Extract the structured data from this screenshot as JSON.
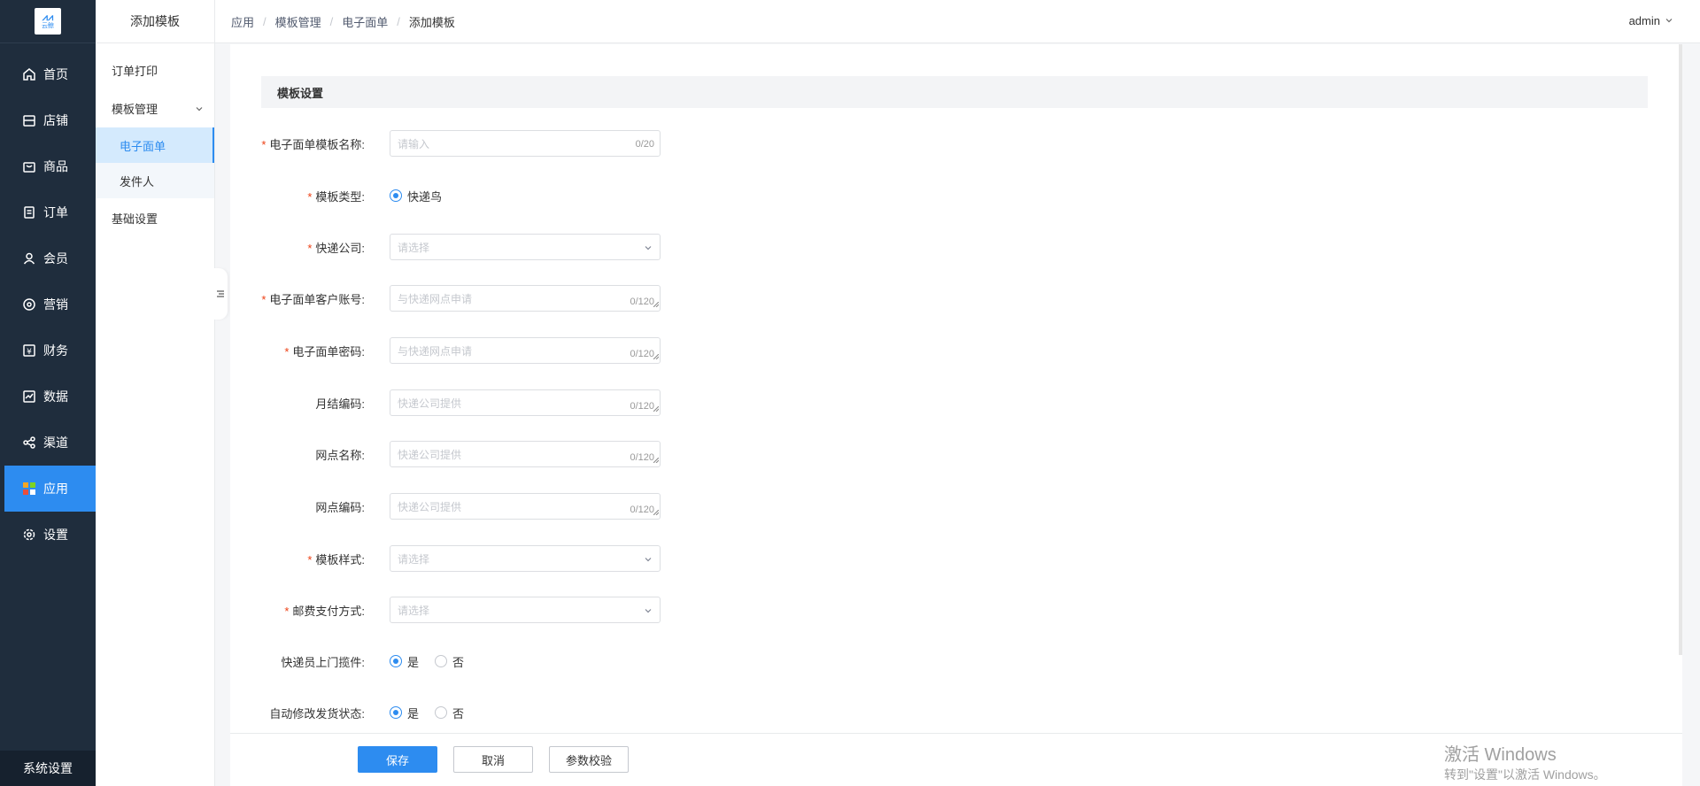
{
  "nav": {
    "logo_text": "云鲸",
    "items": [
      {
        "label": "首页",
        "icon": "home-icon"
      },
      {
        "label": "店铺",
        "icon": "store-icon"
      },
      {
        "label": "商品",
        "icon": "bag-icon"
      },
      {
        "label": "订单",
        "icon": "order-icon"
      },
      {
        "label": "会员",
        "icon": "user-icon"
      },
      {
        "label": "营销",
        "icon": "marketing-icon"
      },
      {
        "label": "财务",
        "icon": "yen-icon"
      },
      {
        "label": "数据",
        "icon": "chart-icon"
      },
      {
        "label": "渠道",
        "icon": "share-icon"
      },
      {
        "label": "应用",
        "icon": "apps-icon"
      },
      {
        "label": "设置",
        "icon": "gear-icon"
      }
    ],
    "active_index": 9,
    "footer": "系统设置"
  },
  "subnav": {
    "title": "添加模板",
    "items": [
      "订单打印",
      "模板管理",
      "电子面单",
      "发件人",
      "基础设置"
    ]
  },
  "header": {
    "breadcrumbs": [
      "应用",
      "模板管理",
      "电子面单",
      "添加模板"
    ],
    "user": "admin"
  },
  "form": {
    "section_title": "模板设置",
    "name": {
      "label": "电子面单模板名称:",
      "placeholder": "请输入",
      "count": "0/20"
    },
    "type": {
      "label": "模板类型:",
      "option": "快递鸟"
    },
    "company": {
      "label": "快递公司:",
      "placeholder": "请选择"
    },
    "account": {
      "label": "电子面单客户账号:",
      "placeholder": "与快递网点申请",
      "count": "0/120"
    },
    "password": {
      "label": "电子面单密码:",
      "placeholder": "与快递网点申请",
      "count": "0/120"
    },
    "monthly": {
      "label": "月结编码:",
      "placeholder": "快递公司提供",
      "count": "0/120"
    },
    "site_name": {
      "label": "网点名称:",
      "placeholder": "快递公司提供",
      "count": "0/120"
    },
    "site_code": {
      "label": "网点编码:",
      "placeholder": "快递公司提供",
      "count": "0/120"
    },
    "style": {
      "label": "模板样式:",
      "placeholder": "请选择"
    },
    "payment": {
      "label": "邮费支付方式:",
      "placeholder": "请选择"
    },
    "pickup": {
      "label": "快递员上门揽件:",
      "yes": "是",
      "no": "否",
      "selected": "是"
    },
    "auto_status": {
      "label": "自动修改发货状态:",
      "yes": "是",
      "no": "否",
      "selected": "是"
    }
  },
  "actions": {
    "save": "保存",
    "cancel": "取消",
    "verify": "参数校验"
  },
  "watermark": {
    "line1": "激活 Windows",
    "line2": "转到\"设置\"以激活 Windows。"
  },
  "colors": {
    "primary": "#2d8cf0",
    "nav_bg": "#1f2d3d",
    "required": "#ed4014"
  }
}
